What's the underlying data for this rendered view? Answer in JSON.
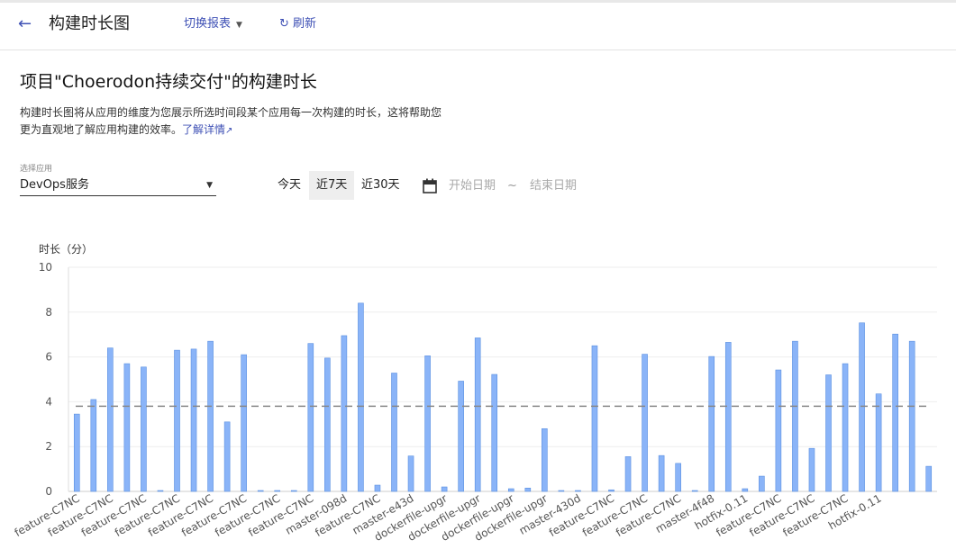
{
  "header": {
    "back_icon": "arrow-left-icon",
    "title": "构建时长图",
    "switch_report_label": "切换报表",
    "refresh_label": "刷新",
    "refresh_icon": "refresh-icon"
  },
  "page": {
    "heading": "项目\"Choerodon持续交付\"的构建时长",
    "desc_line1": "构建时长图将从应用的维度为您展示所选时间段某个应用每一次构建的时长，这将帮助您",
    "desc_line2": "更为直观地了解应用构建的效率。",
    "learn_more": "了解详情"
  },
  "filter": {
    "select_label": "选择应用",
    "select_value": "DevOps服务",
    "ranges": [
      "今天",
      "近7天",
      "近30天"
    ],
    "active_range": "近7天",
    "start_placeholder": "开始日期",
    "end_placeholder": "结束日期",
    "separator": "~"
  },
  "chart_data": {
    "type": "bar",
    "ylabel": "时长（分）",
    "ylim": [
      0,
      10
    ],
    "yticks": [
      0,
      2,
      4,
      6,
      8,
      10
    ],
    "average": 3.8,
    "bar_color": "#8ab4f8",
    "bar_border": "#5a8fe0",
    "values": [
      3.45,
      4.1,
      6.4,
      5.7,
      5.55,
      0.03,
      6.3,
      6.35,
      6.7,
      3.1,
      6.1,
      0.03,
      0.03,
      0.03,
      6.6,
      5.95,
      6.95,
      8.4,
      0.28,
      5.28,
      1.58,
      6.05,
      0.2,
      4.92,
      6.85,
      5.22,
      0.12,
      0.15,
      2.8,
      0.03,
      0.03,
      6.5,
      0.07,
      1.55,
      6.12,
      1.6,
      1.25,
      0.03,
      6.02,
      6.65,
      0.12,
      0.68,
      5.42,
      6.7,
      1.92,
      5.2,
      5.7,
      7.52,
      4.35,
      7.02,
      6.7,
      1.12
    ],
    "x_tick_labels": [
      "feature-C7NC",
      "feature-C7NC",
      "feature-C7NC",
      "feature-C7NC",
      "feature-C7NC",
      "feature-C7NC",
      "feature-C7NC",
      "feature-C7NC",
      "master-098d",
      "feature-C7NC",
      "master-e43d",
      "dockerfile-upgr",
      "dockerfile-upgr",
      "dockerfile-upgr",
      "dockerfile-upgr",
      "master-430d",
      "feature-C7NC",
      "feature-C7NC",
      "feature-C7NC",
      "master-4f48",
      "hotfix-0.11",
      "feature-C7NC",
      "feature-C7NC",
      "feature-C7NC",
      "hotfix-0.11"
    ]
  }
}
